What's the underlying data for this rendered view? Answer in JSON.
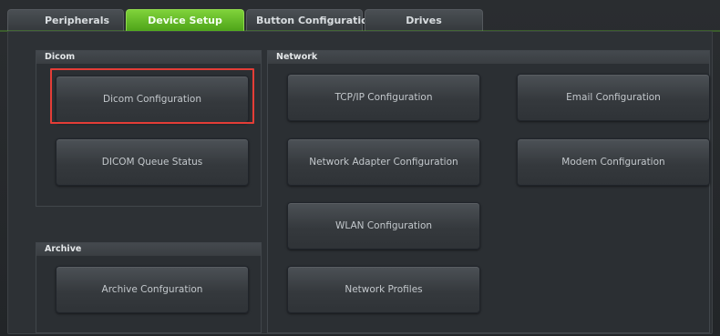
{
  "tabs": [
    {
      "label": "Peripherals",
      "active": false
    },
    {
      "label": "Device Setup",
      "active": true
    },
    {
      "label": "Button Configuration",
      "active": false
    },
    {
      "label": "Drives",
      "active": false
    }
  ],
  "groups": {
    "dicom": {
      "title": "Dicom",
      "buttons": [
        "Dicom Configuration",
        "DICOM Queue Status"
      ]
    },
    "archive": {
      "title": "Archive",
      "buttons": [
        "Archive Confguration"
      ]
    },
    "network": {
      "title": "Network",
      "buttons": [
        "TCP/IP Configuration",
        "Email Configuration",
        "Network Adapter Configuration",
        "Modem Configuration",
        "WLAN Configuration",
        "Network Profiles"
      ]
    }
  },
  "colors": {
    "active_tab": "#5fb82a",
    "highlight": "#e43d37",
    "background": "#26292c"
  }
}
